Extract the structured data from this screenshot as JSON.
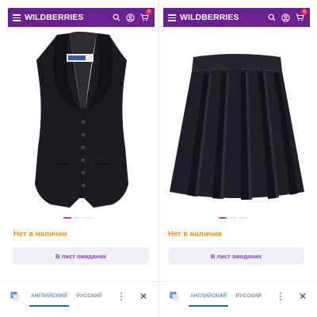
{
  "panels": [
    {
      "brand": "WILDBERRIES",
      "cart_count": "0",
      "product": "vest",
      "stock_status": "Нет в наличии",
      "wait_button": "В лист ожидания",
      "translate": {
        "lang_active": "АНГЛИЙСКИЙ",
        "lang_other": "РУССКИЙ"
      },
      "slide_count": 3,
      "active_slide": 1
    },
    {
      "brand": "WILDBERRIES",
      "cart_count": "0",
      "product": "pleated-skirt",
      "stock_status": "Нет в наличии",
      "wait_button": "В лист ожидания",
      "translate": {
        "lang_active": "АНГЛИЙСКИЙ",
        "lang_other": "РУССКИЙ"
      },
      "slide_count": 3,
      "active_slide": 1
    }
  ],
  "colors": {
    "header": "#6b2192",
    "stock": "#f09012",
    "button_text": "#8d3cc8",
    "accent_blue": "#1967d2",
    "badge": "#f2295b"
  },
  "icons": [
    "menu-icon",
    "search-icon",
    "account-icon",
    "cart-icon",
    "google-translate-icon",
    "more-vert-icon",
    "close-icon"
  ]
}
